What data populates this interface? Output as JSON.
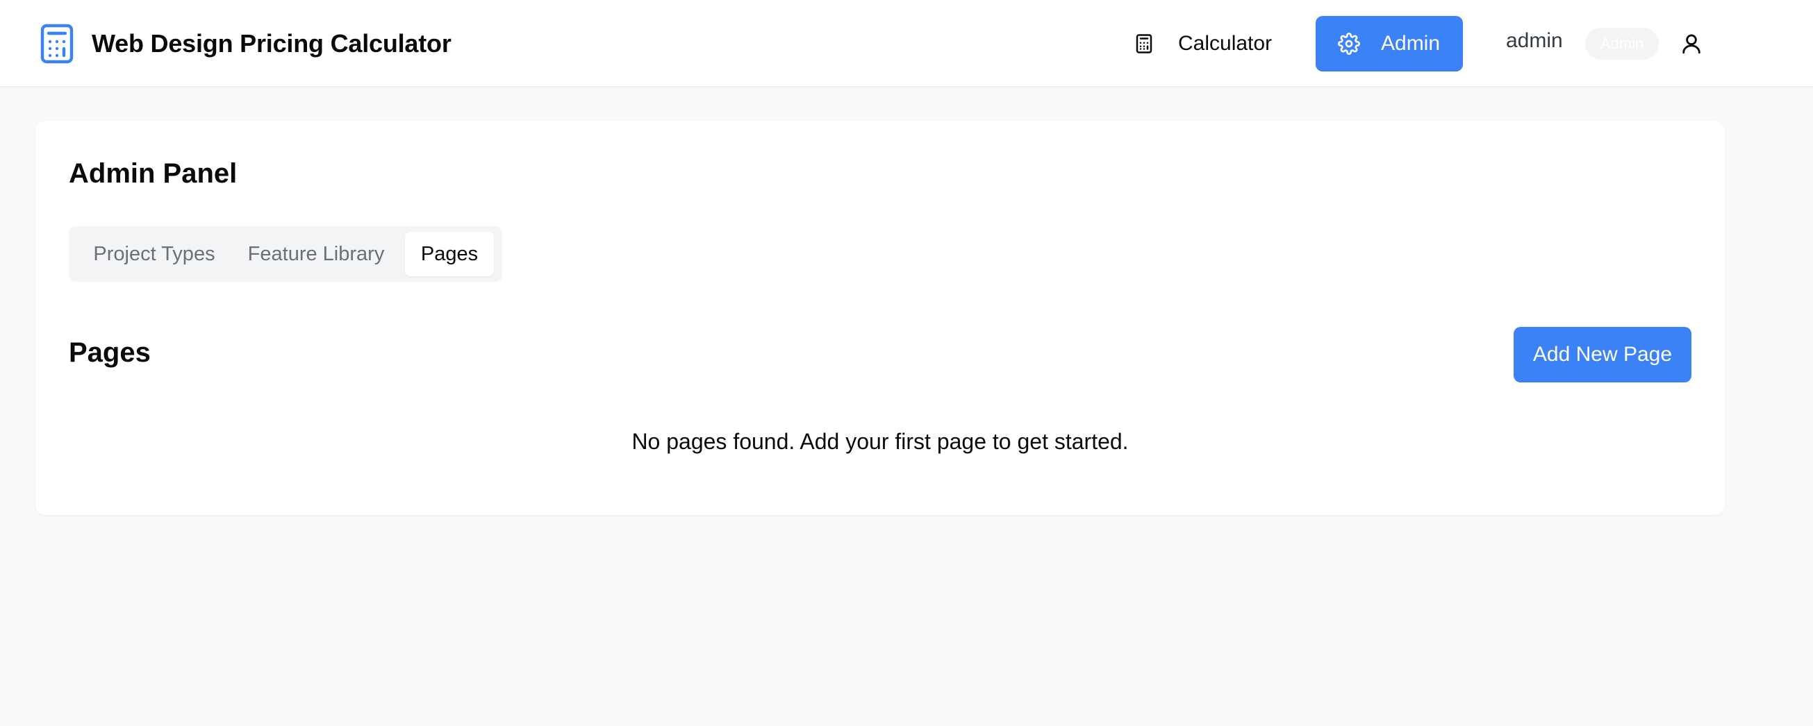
{
  "header": {
    "app_title": "Web Design Pricing Calculator",
    "logo_icon": "calculator-icon",
    "nav": {
      "calculator_label": "Calculator",
      "calculator_icon": "calculator-icon",
      "admin_label": "Admin",
      "admin_icon": "gear-icon"
    },
    "user": {
      "name": "admin",
      "role_badge": "Admin",
      "icon": "user-icon"
    }
  },
  "admin_panel": {
    "title": "Admin Panel",
    "tabs": [
      {
        "label": "Project Types",
        "active": false
      },
      {
        "label": "Feature Library",
        "active": false
      },
      {
        "label": "Pages",
        "active": true
      }
    ],
    "section_title": "Pages",
    "add_button_label": "Add New Page",
    "empty_message": "No pages found. Add your first page to get started."
  },
  "colors": {
    "accent": "#3b82f6",
    "background": "#f8f9fb",
    "surface": "#ffffff"
  }
}
